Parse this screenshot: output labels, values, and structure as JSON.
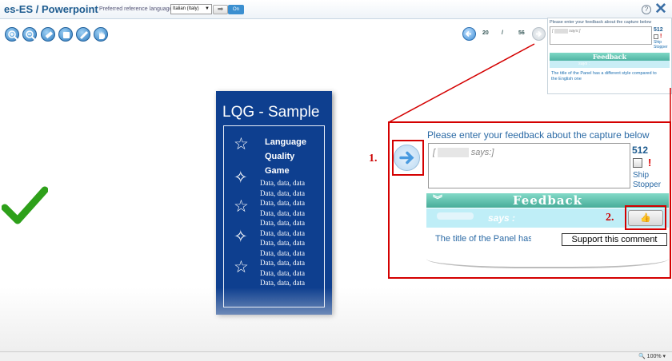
{
  "header": {
    "title": "es-ES / Powerpoint",
    "pref_label": "Preferred reference language",
    "language": "Italian (Italy)",
    "on_label": "On",
    "help": "?"
  },
  "toolbar": {
    "icons": [
      "zoom-in-icon",
      "zoom-out-icon",
      "eraser-icon",
      "square-icon",
      "pen-icon",
      "hand-icon"
    ]
  },
  "pager": {
    "current": "20",
    "separator": "/",
    "total": "56"
  },
  "thumbnail": {
    "prompt": "Please enter your feedback about the capture below",
    "says": "says:]",
    "count": "512",
    "ship_stopper": "Ship Stopper",
    "feedback_title": "Feedback",
    "says_label": "says :",
    "comment": "The title of the Panel has a different style compared to the English one"
  },
  "slide": {
    "title": "LQG - Sample",
    "game_lines": [
      "Language",
      "Quality",
      "Game"
    ],
    "data_line": "Data, data, data"
  },
  "zoom": {
    "prompt": "Please enter your feedback about the capture below",
    "box_prefix": "[",
    "box_says": "says:]",
    "count": "512",
    "excl": "!",
    "ship_stopper": "Ship Stopper",
    "feedback_title": "Feedback",
    "says_label": "says :",
    "comment": "The title of the Panel has a different style compared to the English one",
    "tooltip": "Support this comment",
    "step1": "1.",
    "step2": "2."
  },
  "status": {
    "zoom_level": "100%"
  },
  "colors": {
    "accent": "#1d5b8f",
    "slide_bg": "#0e3f8f",
    "feedback_teal": "#4fb3a2",
    "callout_red": "#d40000",
    "check_green": "#2ea01a"
  }
}
